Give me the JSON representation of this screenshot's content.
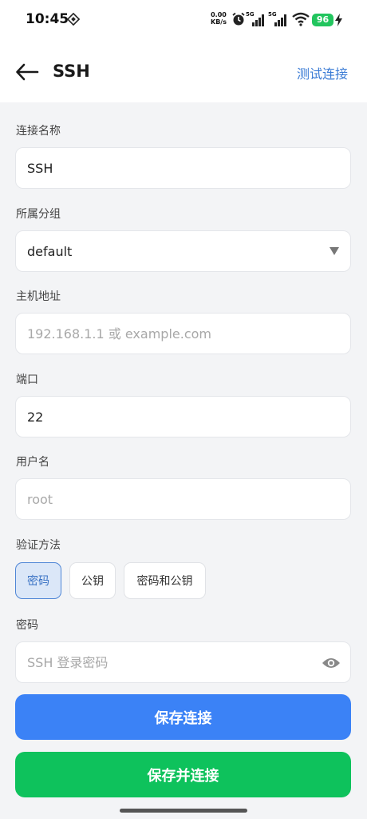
{
  "status_bar": {
    "time": "10:45",
    "net_speed_value": "0.00",
    "net_speed_unit": "KB/s",
    "signal1_tag": "5G",
    "signal2_tag": "5G",
    "battery": "96"
  },
  "app_bar": {
    "title": "SSH",
    "action": "测试连接"
  },
  "form": {
    "name": {
      "label": "连接名称",
      "value": "SSH"
    },
    "group": {
      "label": "所属分组",
      "value": "default"
    },
    "host": {
      "label": "主机地址",
      "placeholder": "192.168.1.1 或 example.com",
      "value": ""
    },
    "port": {
      "label": "端口",
      "value": "22"
    },
    "username": {
      "label": "用户名",
      "placeholder": "root",
      "value": ""
    },
    "auth": {
      "label": "验证方法",
      "options": [
        "密码",
        "公钥",
        "密码和公钥"
      ],
      "selected": "密码"
    },
    "password": {
      "label": "密码",
      "placeholder": "SSH 登录密码",
      "value": ""
    }
  },
  "buttons": {
    "save": "保存连接",
    "save_and_connect": "保存并连接"
  },
  "colors": {
    "accent": "#3b82f6",
    "success": "#0ec25c",
    "link": "#3a7bd5"
  },
  "icons": [
    "diamond-status-icon",
    "alarm-icon",
    "signal-icon",
    "wifi-icon",
    "bolt-icon",
    "back-arrow-icon",
    "dropdown-triangle-icon",
    "eye-icon"
  ]
}
